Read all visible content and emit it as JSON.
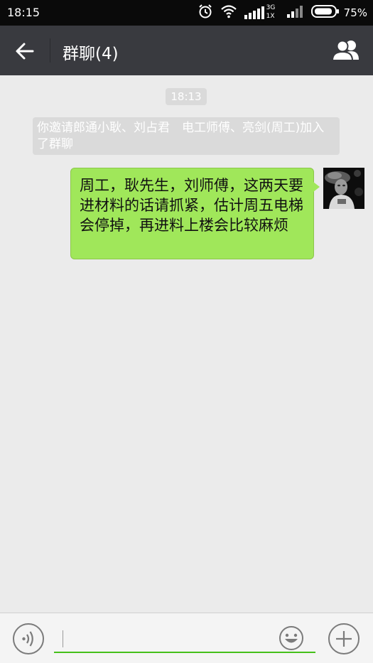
{
  "status_bar": {
    "time": "18:15",
    "network_3g": "3G",
    "network_1x": "1X",
    "battery_percent": "75%",
    "icons": [
      "alarm-icon",
      "wifi-icon",
      "signal-icon",
      "signal-icon",
      "battery-icon"
    ]
  },
  "header": {
    "title": "群聊(4)",
    "back_icon": "back-arrow-icon",
    "members_icon": "group-members-icon",
    "background_color": "#393a3f"
  },
  "chat": {
    "timestamp": "18:13",
    "system_message": "你邀请郎通小耿、刘占君　电工师傅、亮剑(周工)加入了群聊",
    "messages": [
      {
        "sender": "self",
        "text": "周工，耿先生，刘师傅，这两天要进材料的话请抓紧，估计周五电梯会停掉，再进料上楼会比较麻烦",
        "bubble_color": "#a0e75a"
      }
    ],
    "background_color": "#ebebeb"
  },
  "input_bar": {
    "value": "",
    "voice_icon": "voice-icon",
    "emoji_icon": "emoji-icon",
    "plus_icon": "plus-icon",
    "accent_color": "#45c01a"
  }
}
